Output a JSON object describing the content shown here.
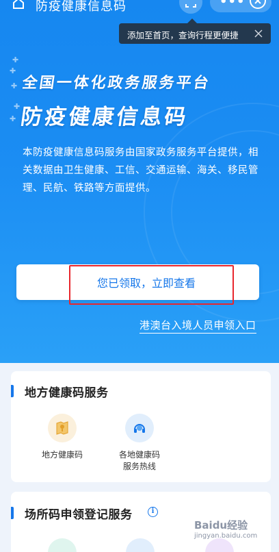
{
  "topbar": {
    "title": "防疫健康信息码",
    "home_icon": "home-icon",
    "scan_icon": "scan-icon",
    "more_icon": "more-icon",
    "close_icon": "close-icon"
  },
  "tooltip": {
    "text": "添加至首页，查询行程更便捷",
    "close_icon": "close-icon"
  },
  "hero": {
    "platform_title": "全国一体化政务服务平台",
    "code_title": "防疫健康信息码",
    "description": "本防疫健康信息码服务由国家政务服务平台提供，相关数据由卫生健康、工信、交通运输、海关、移民管理、民航、铁路等方面提供。",
    "claim_button": "您已领取，立即查看",
    "hk_link": "港澳台入境人员申领入口",
    "highlight_color": "#e8262c"
  },
  "section_local": {
    "title": "地方健康码服务",
    "items": [
      {
        "label": "地方健康码",
        "icon": "map-pin-icon",
        "icon_bg": "#fbf0dc"
      },
      {
        "label": "各地健康码服务热线",
        "label_line1": "各地健康码",
        "label_line2": "服务热线",
        "icon": "headset-icon",
        "icon_bg": "#e1eefc"
      }
    ]
  },
  "section_venue": {
    "title": "场所码申领登记服务",
    "info_icon": "info-icon"
  },
  "watermark": {
    "text": "Baidu经验",
    "sub": "jingyan.baidu.com"
  },
  "colors": {
    "accent": "#1677ea",
    "hero_top": "#1687f0",
    "hero_bottom": "#2aa0f7"
  }
}
